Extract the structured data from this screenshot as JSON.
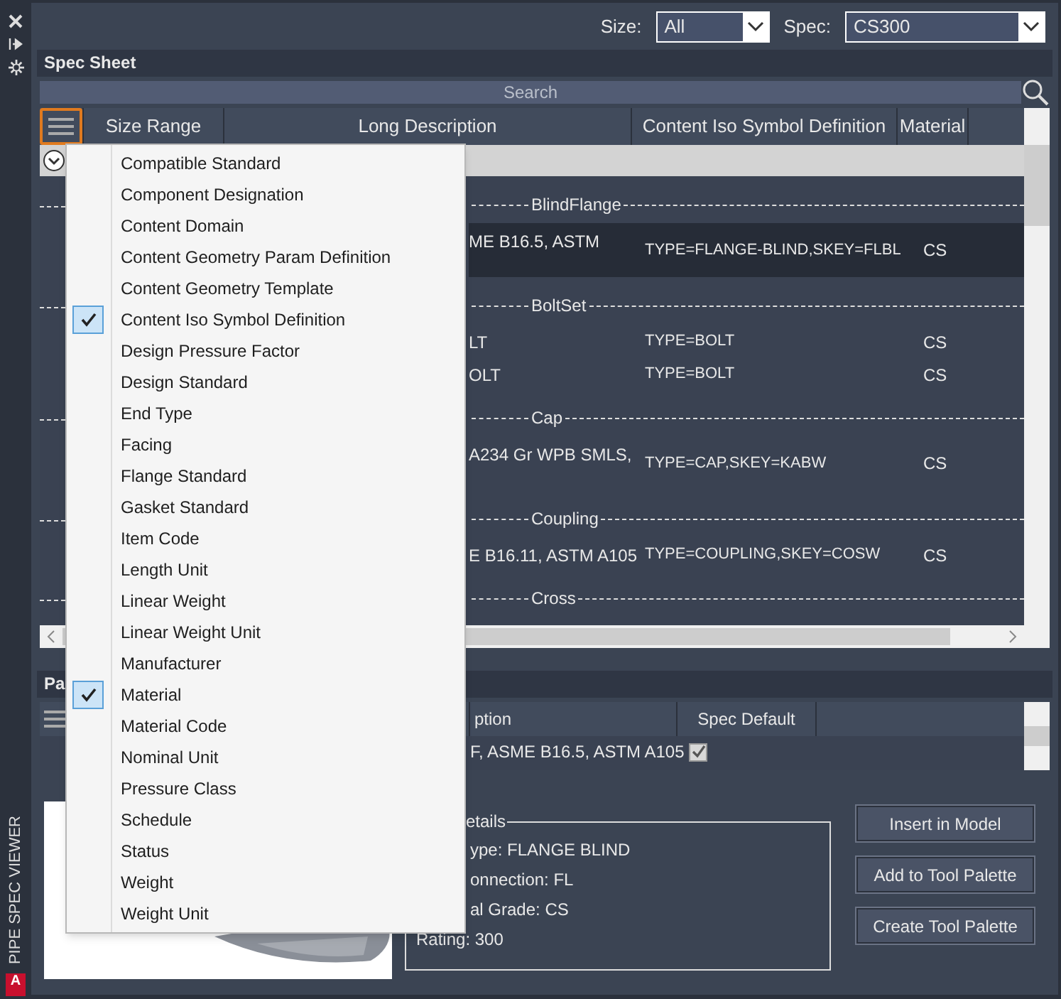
{
  "side_strip": {
    "title": "PIPE SPEC VIEWER",
    "logo": "A"
  },
  "filters": [
    {
      "label": "Size:",
      "value": "All"
    },
    {
      "label": "Spec:",
      "value": "CS300"
    }
  ],
  "spec_sheet": {
    "title": "Spec Sheet",
    "search_placeholder": "Search",
    "columns": [
      "Size Range",
      "Long Description",
      "Content Iso Symbol Definition",
      "Material"
    ],
    "groups": [
      {
        "name": "BlindFlange",
        "rows": [
          {
            "description": "ME B16.5, ASTM",
            "iso": "TYPE=FLANGE-BLIND,SKEY=FLBL",
            "material": "CS",
            "selected": true,
            "tall": true
          }
        ]
      },
      {
        "name": "BoltSet",
        "rows": [
          {
            "description": "LT",
            "iso": "TYPE=BOLT",
            "material": "CS",
            "selected": false,
            "tall": false
          },
          {
            "description": "OLT",
            "iso": "TYPE=BOLT",
            "material": "CS",
            "selected": false,
            "tall": false
          }
        ]
      },
      {
        "name": "Cap",
        "rows": [
          {
            "description": "A234 Gr WPB SMLS,",
            "iso": "TYPE=CAP,SKEY=KABW",
            "material": "CS",
            "selected": false,
            "tall": true
          }
        ]
      },
      {
        "name": "Coupling",
        "rows": [
          {
            "description": "E B16.11, ASTM A105",
            "iso": "TYPE=COUPLING,SKEY=COSW",
            "material": "CS",
            "selected": false,
            "tall": false
          }
        ]
      },
      {
        "name": "Cross"
      }
    ]
  },
  "parts": {
    "title": "Pa",
    "columns": [
      "ption",
      "Spec Default"
    ],
    "rows": [
      {
        "description": "F, ASME B16.5, ASTM A105",
        "spec_default": true
      }
    ]
  },
  "details": {
    "legend": "etails",
    "lines": [
      {
        "text": "ype: FLANGE BLIND",
        "clipped": true
      },
      {
        "text": "onnection: FL",
        "clipped": true
      },
      {
        "text": "al Grade: CS",
        "clipped": true
      },
      {
        "text": "Rating: 300",
        "clipped": false
      }
    ]
  },
  "buttons": [
    "Insert in Model",
    "Add to Tool Palette",
    "Create Tool Palette"
  ],
  "column_menu": [
    {
      "label": "Compatible Standard",
      "checked": false
    },
    {
      "label": "Component Designation",
      "checked": false
    },
    {
      "label": "Content Domain",
      "checked": false
    },
    {
      "label": "Content Geometry Param Definition",
      "checked": false
    },
    {
      "label": "Content Geometry Template",
      "checked": false
    },
    {
      "label": "Content Iso Symbol Definition",
      "checked": true
    },
    {
      "label": "Design Pressure Factor",
      "checked": false
    },
    {
      "label": "Design Standard",
      "checked": false
    },
    {
      "label": "End Type",
      "checked": false
    },
    {
      "label": "Facing",
      "checked": false
    },
    {
      "label": "Flange Standard",
      "checked": false
    },
    {
      "label": "Gasket Standard",
      "checked": false
    },
    {
      "label": "Item Code",
      "checked": false
    },
    {
      "label": "Length Unit",
      "checked": false
    },
    {
      "label": "Linear Weight",
      "checked": false
    },
    {
      "label": "Linear Weight Unit",
      "checked": false
    },
    {
      "label": "Manufacturer",
      "checked": false
    },
    {
      "label": "Material",
      "checked": true
    },
    {
      "label": "Material Code",
      "checked": false
    },
    {
      "label": "Nominal Unit",
      "checked": false
    },
    {
      "label": "Pressure Class",
      "checked": false
    },
    {
      "label": "Schedule",
      "checked": false
    },
    {
      "label": "Status",
      "checked": false
    },
    {
      "label": "Weight",
      "checked": false
    },
    {
      "label": "Weight Unit",
      "checked": false
    }
  ]
}
